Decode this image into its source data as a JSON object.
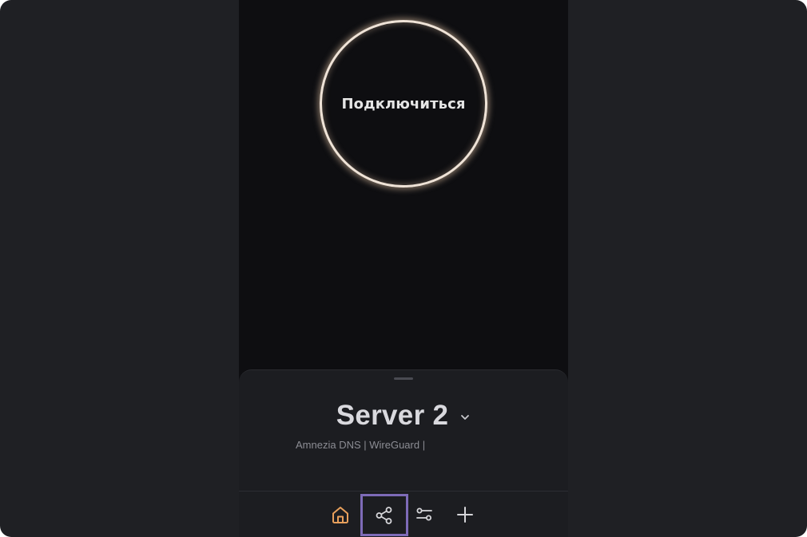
{
  "main": {
    "connect_label": "Подключиться"
  },
  "server": {
    "name": "Server 2",
    "description": "Amnezia DNS | WireGuard |"
  },
  "nav": {
    "items": [
      {
        "name": "home",
        "icon": "home-icon",
        "color": "#e8a05c",
        "active": true
      },
      {
        "name": "share",
        "icon": "share-icon",
        "color": "#d6d6da",
        "active": false
      },
      {
        "name": "settings",
        "icon": "settings-icon",
        "color": "#d6d6da",
        "active": false
      },
      {
        "name": "add",
        "icon": "plus-icon",
        "color": "#d6d6da",
        "active": false
      }
    ]
  },
  "colors": {
    "background": "#1f2024",
    "app_background": "#0e0e11",
    "sheet": "#1c1d21",
    "accent": "#e8a05c",
    "highlight": "#7e6bb8"
  }
}
